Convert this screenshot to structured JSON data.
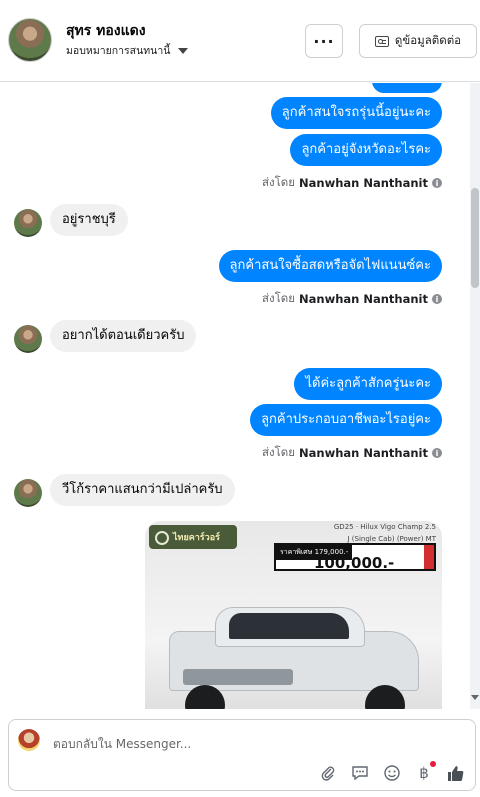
{
  "header": {
    "name": "สุทร ทองแดง",
    "assign_label": "มอบหมายการสนทนานี้",
    "more_label": "···",
    "contact_label": "ดูข้อมูลติดต่อ"
  },
  "messages": {
    "out1": "ลูกค้าสนใจรถรุ่นนี้อยู่นะคะ",
    "out2": "ลูกค้าอยู่จังหวัดอะไรคะ",
    "sent_prefix": "ส่งโดย",
    "sender": "Nanwhan Nanthanit",
    "in1": "อยู่ราชบุรี",
    "out3": "ลูกค้าสนใจซื้อสดหรือจัดไฟแนนซ์คะ",
    "in2": "อยากได้ตอนเดียวครับ",
    "out4": "ได้ค่ะลูกค้าสักครู่นะคะ",
    "out5": "ลูกค้าประกอบอาชีพอะไรอยู่คะ",
    "in3": "วีโก้ราคาแสนกว่ามีเปล่าครับ"
  },
  "photo": {
    "brand": "ไทยคาร์วอร์",
    "topline": "GD25 · Hilux Vigo Champ 2.5",
    "subline": "J (Single Cab) (Power) MT",
    "price_tag": "ราคาพิเศษ 179,000.-",
    "price": "100,000.-"
  },
  "composer": {
    "placeholder": "ตอบกลับใน Messenger..."
  },
  "icons": [
    "more-icon",
    "id-card-icon",
    "info-icon",
    "attach-icon",
    "saved-reply-icon",
    "emoji-icon",
    "baht-icon",
    "like-icon"
  ],
  "colors": {
    "accent": "#0084ff",
    "bubble_in": "#f0f0f0",
    "notif_dot": "#e41e3f"
  }
}
